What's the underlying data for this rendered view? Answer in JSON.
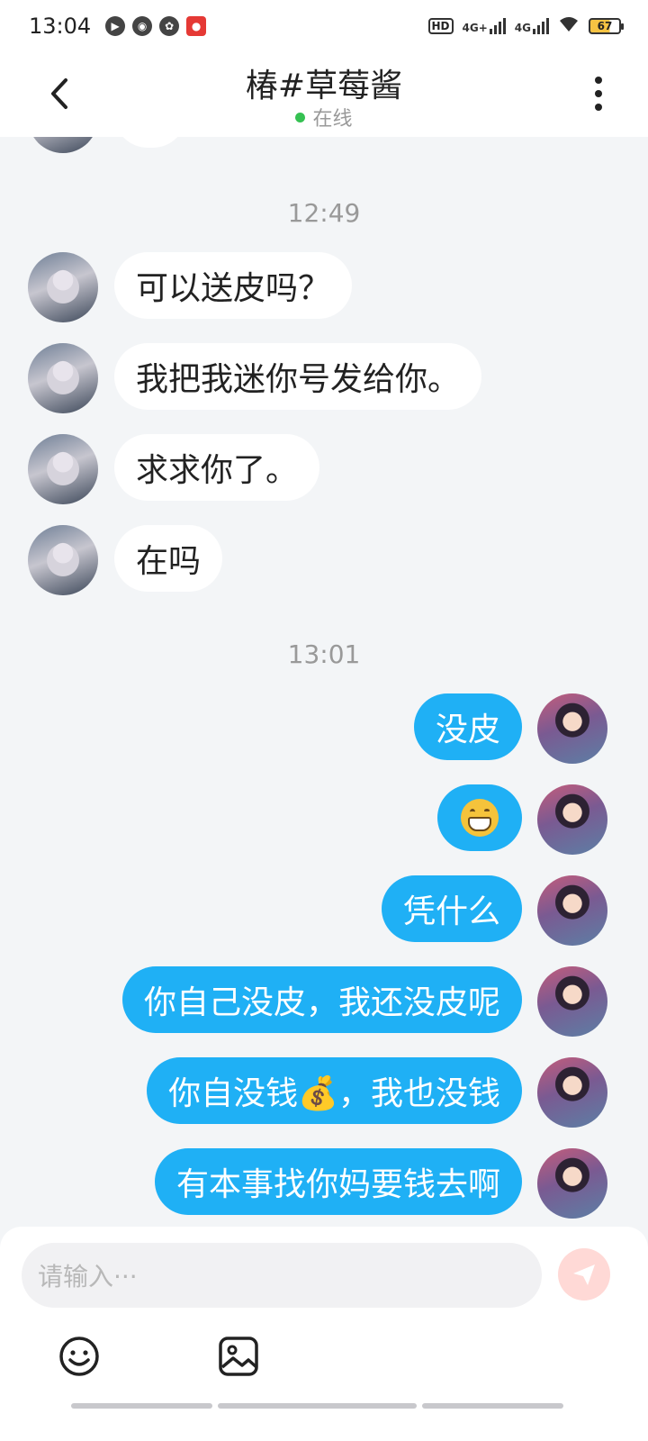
{
  "status_bar": {
    "time": "13:04",
    "network_1": "4G+",
    "network_2": "4G",
    "battery": "67"
  },
  "header": {
    "title": "椿#草莓酱",
    "status": "在线"
  },
  "timestamps": [
    "12:49",
    "13:01"
  ],
  "incoming_messages": [
    "可以送皮吗？",
    "我把我迷你号发给你。",
    "求求你了。",
    "在吗"
  ],
  "outgoing_messages": [
    "没皮",
    "😁",
    "凭什么",
    "你自己没皮，我还没皮呢",
    "你自没钱💰，我也没钱",
    "有本事找你妈要钱去啊"
  ],
  "input": {
    "placeholder": "请输入···"
  },
  "colors": {
    "bubble_out": "#1fb0f5",
    "bubble_in": "#ffffff",
    "background": "#f3f5f7",
    "online": "#35c152",
    "send_button": "#ffd9d6"
  }
}
